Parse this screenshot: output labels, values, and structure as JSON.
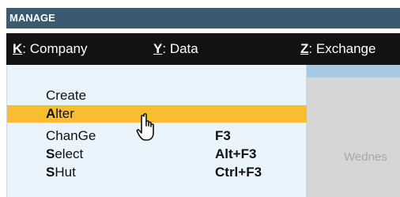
{
  "header": {
    "section_title": "MANAGE"
  },
  "menubar": {
    "items": [
      {
        "key": "K",
        "sep": ":",
        "label": "Company"
      },
      {
        "key": "Y",
        "sep": ":",
        "label": "Data"
      },
      {
        "key": "Z",
        "sep": ":",
        "label": "Exchange"
      }
    ]
  },
  "dropdown": {
    "items": [
      {
        "key": "",
        "rest": "Create",
        "shortcut": ""
      },
      {
        "key": "A",
        "rest": "lter",
        "shortcut": "",
        "selected": true
      },
      {
        "key": "",
        "rest": "ChanGe",
        "shortcut": "F3"
      },
      {
        "key": "S",
        "rest": "elect",
        "shortcut": "Alt+F3"
      },
      {
        "key": "S",
        "rest": "Hut",
        "shortcut": "Ctrl+F3"
      }
    ]
  },
  "background": {
    "weekday_partial": "Wednes"
  },
  "colors": {
    "menubar_bg": "#111315",
    "section_bg": "#3a5a72",
    "highlight": "#f8be2f",
    "dropdown_bg": "#e9f4fc"
  },
  "icons": {
    "cursor": "hand-pointer-icon"
  }
}
